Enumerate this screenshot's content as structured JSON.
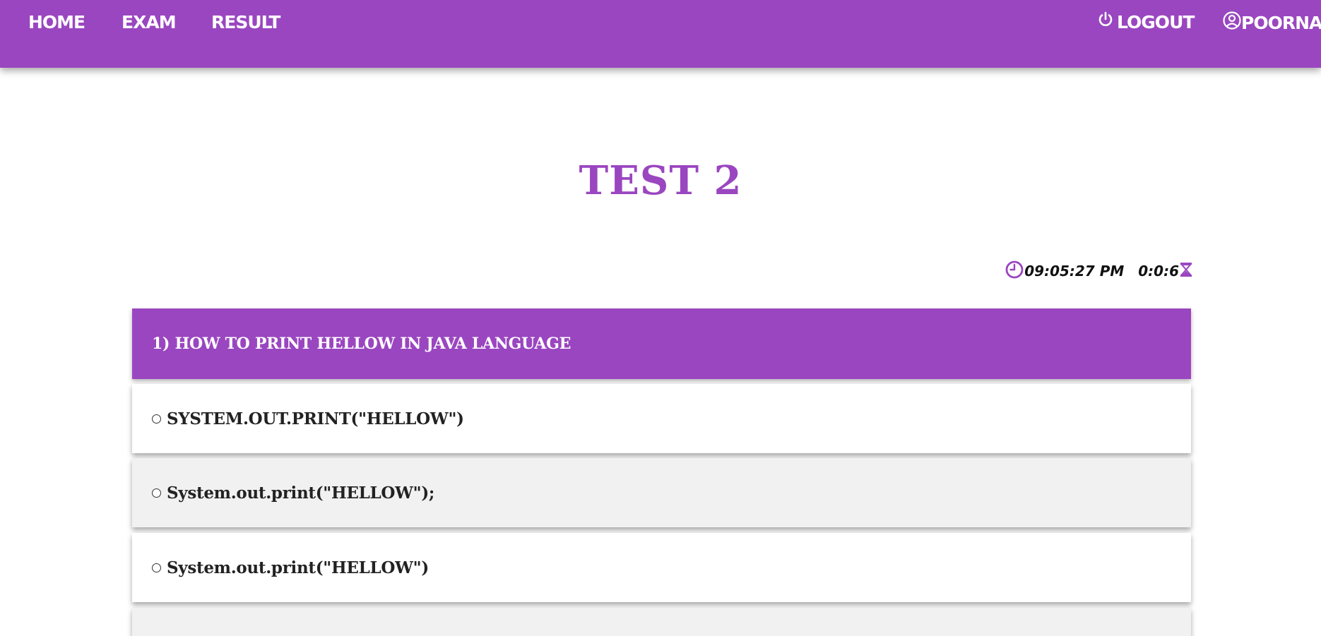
{
  "nav": {
    "home": "HOME",
    "exam": "EXAM",
    "result": "RESULT",
    "logout": "LOGOUT",
    "user": "POORNA",
    "logout_icon": "power-icon",
    "user_icon": "user-circle-icon"
  },
  "test": {
    "title": "TEST 2",
    "clock_time": "09:05:27 PM",
    "elapsed": "0:0:6",
    "clock_icon": "clock-icon",
    "timer_icon": "hourglass-icon"
  },
  "question": {
    "text": "1) HOW TO PRINT HELLOW IN JAVA LANGUAGE",
    "options": [
      "SYSTEM.OUT.PRINT(\"HELLOW\")",
      "System.out.print(\"HELLOW\");",
      "System.out.print(\"HELLOW\")",
      ""
    ]
  },
  "colors": {
    "accent": "#9a46c0",
    "option_alt": "#f1f1f1"
  }
}
